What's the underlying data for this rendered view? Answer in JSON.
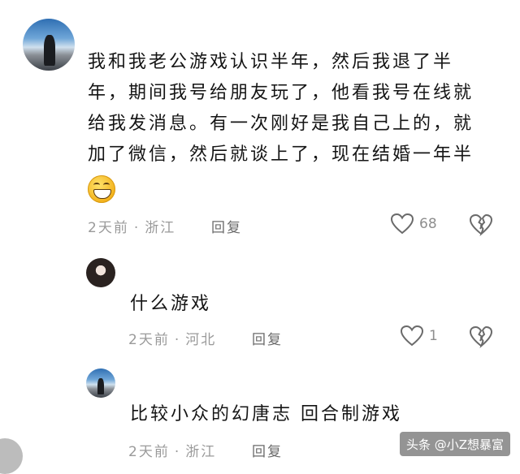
{
  "comments": [
    {
      "text_lines": [
        "我和我老公游戏认识半年，然后我退了半",
        "年，期间我号给朋友玩了，他看我号在线就",
        "给我发消息。有一次刚好是我自己上的，就",
        "加了微信，然后就谈上了，现在结婚一年半"
      ],
      "emoji": "grinning-face",
      "time": "2天前",
      "location": "浙江",
      "reply_label": "回复",
      "likes": "68"
    },
    {
      "text_lines": [
        "什么游戏"
      ],
      "time": "2天前",
      "location": "河北",
      "reply_label": "回复",
      "likes": "1"
    },
    {
      "text_lines": [
        "比较小众的幻唐志 回合制游戏"
      ],
      "time": "2天前",
      "location": "浙江",
      "reply_label": "回复"
    }
  ],
  "separator": "·",
  "watermark": "头条 @小Z想暴富",
  "icons": [
    "heart-outline-icon",
    "broken-heart-icon"
  ],
  "colors": {
    "meta": "#9a9a9a",
    "text": "#151515"
  }
}
